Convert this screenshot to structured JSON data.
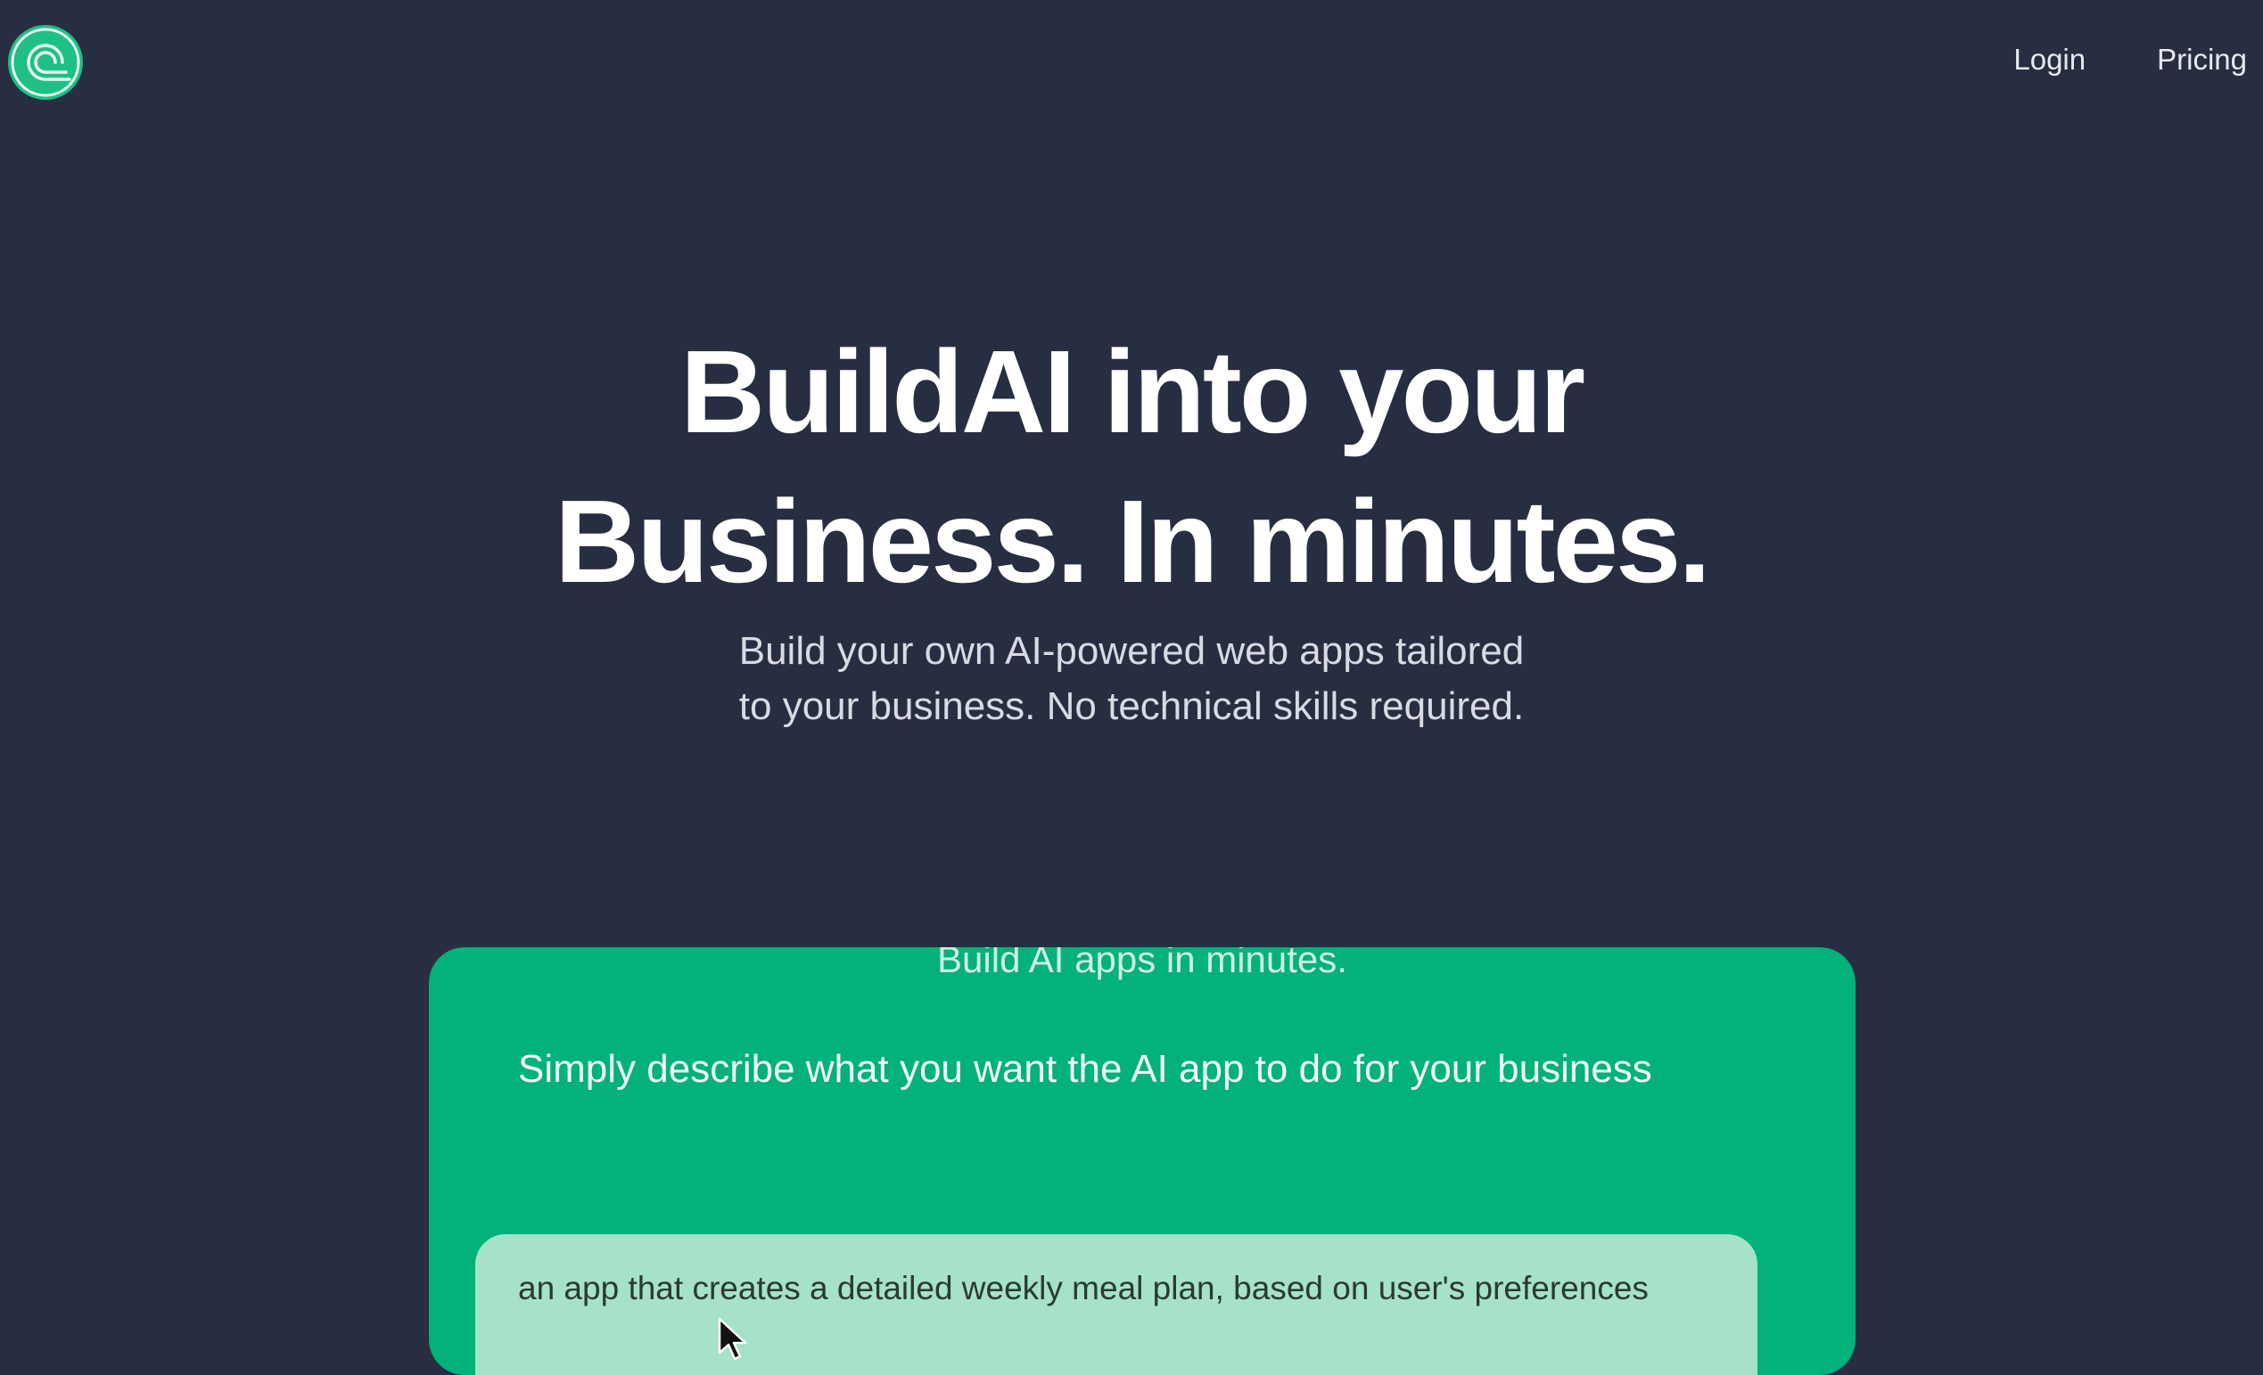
{
  "header": {
    "logo": "logo-icon",
    "nav": [
      "Login",
      "Pricing"
    ]
  },
  "hero": {
    "headline_line1": "BuildAI into your",
    "headline_line2": "Business. In minutes.",
    "subtitle_line1": "Build your own AI-powered web apps tailored",
    "subtitle_line2": "to your business. No technical skills required."
  },
  "demo": {
    "top_caption": "Build AI apps in minutes.",
    "instruction": "Simply describe what you want the AI app to do for your business",
    "input_value": "an app that creates a detailed weekly meal plan, based on user's preferences"
  },
  "colors": {
    "background": "#282e41",
    "accent": "#03b17b",
    "input_bg": "#a6e2c9"
  }
}
